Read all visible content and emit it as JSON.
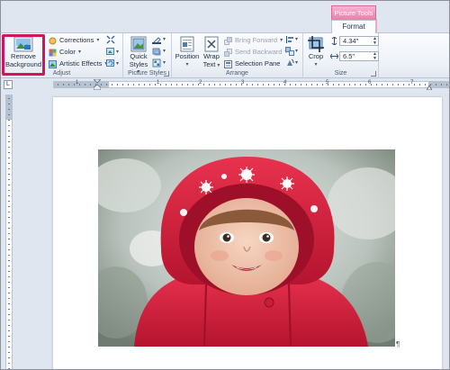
{
  "context_tab": {
    "group_title": "Picture Tools",
    "tab_label": "Format"
  },
  "ribbon": {
    "adjust": {
      "group_label": "Adjust",
      "remove_background": {
        "line1": "Remove",
        "line2": "Background"
      },
      "corrections": "Corrections",
      "color": "Color",
      "artistic_effects": "Artistic Effects"
    },
    "picture_styles": {
      "group_label": "Picture Styles",
      "quick_styles": {
        "line1": "Quick",
        "line2": "Styles"
      }
    },
    "arrange": {
      "group_label": "Arrange",
      "position": "Position",
      "wrap_text": {
        "line1": "Wrap",
        "line2": "Text"
      },
      "bring_forward": "Bring Forward",
      "send_backward": "Send Backward",
      "selection_pane": "Selection Pane"
    },
    "size": {
      "group_label": "Size",
      "crop": "Crop",
      "height_value": "4.34\"",
      "width_value": "6.5\""
    }
  },
  "ruler": {
    "corner_glyph": "L",
    "numbers": [
      "1",
      "1",
      "2",
      "3",
      "4",
      "5",
      "6",
      "7"
    ]
  },
  "document": {
    "paragraph_mark": "¶",
    "picture": "photo of a smiling toddler wearing a red hooded snow jacket with white snowflake prints, snowy trees in background"
  },
  "colors": {
    "highlight": "#d4145a",
    "context_tab": "#ec7fac",
    "jacket_red": "#d8243f"
  }
}
